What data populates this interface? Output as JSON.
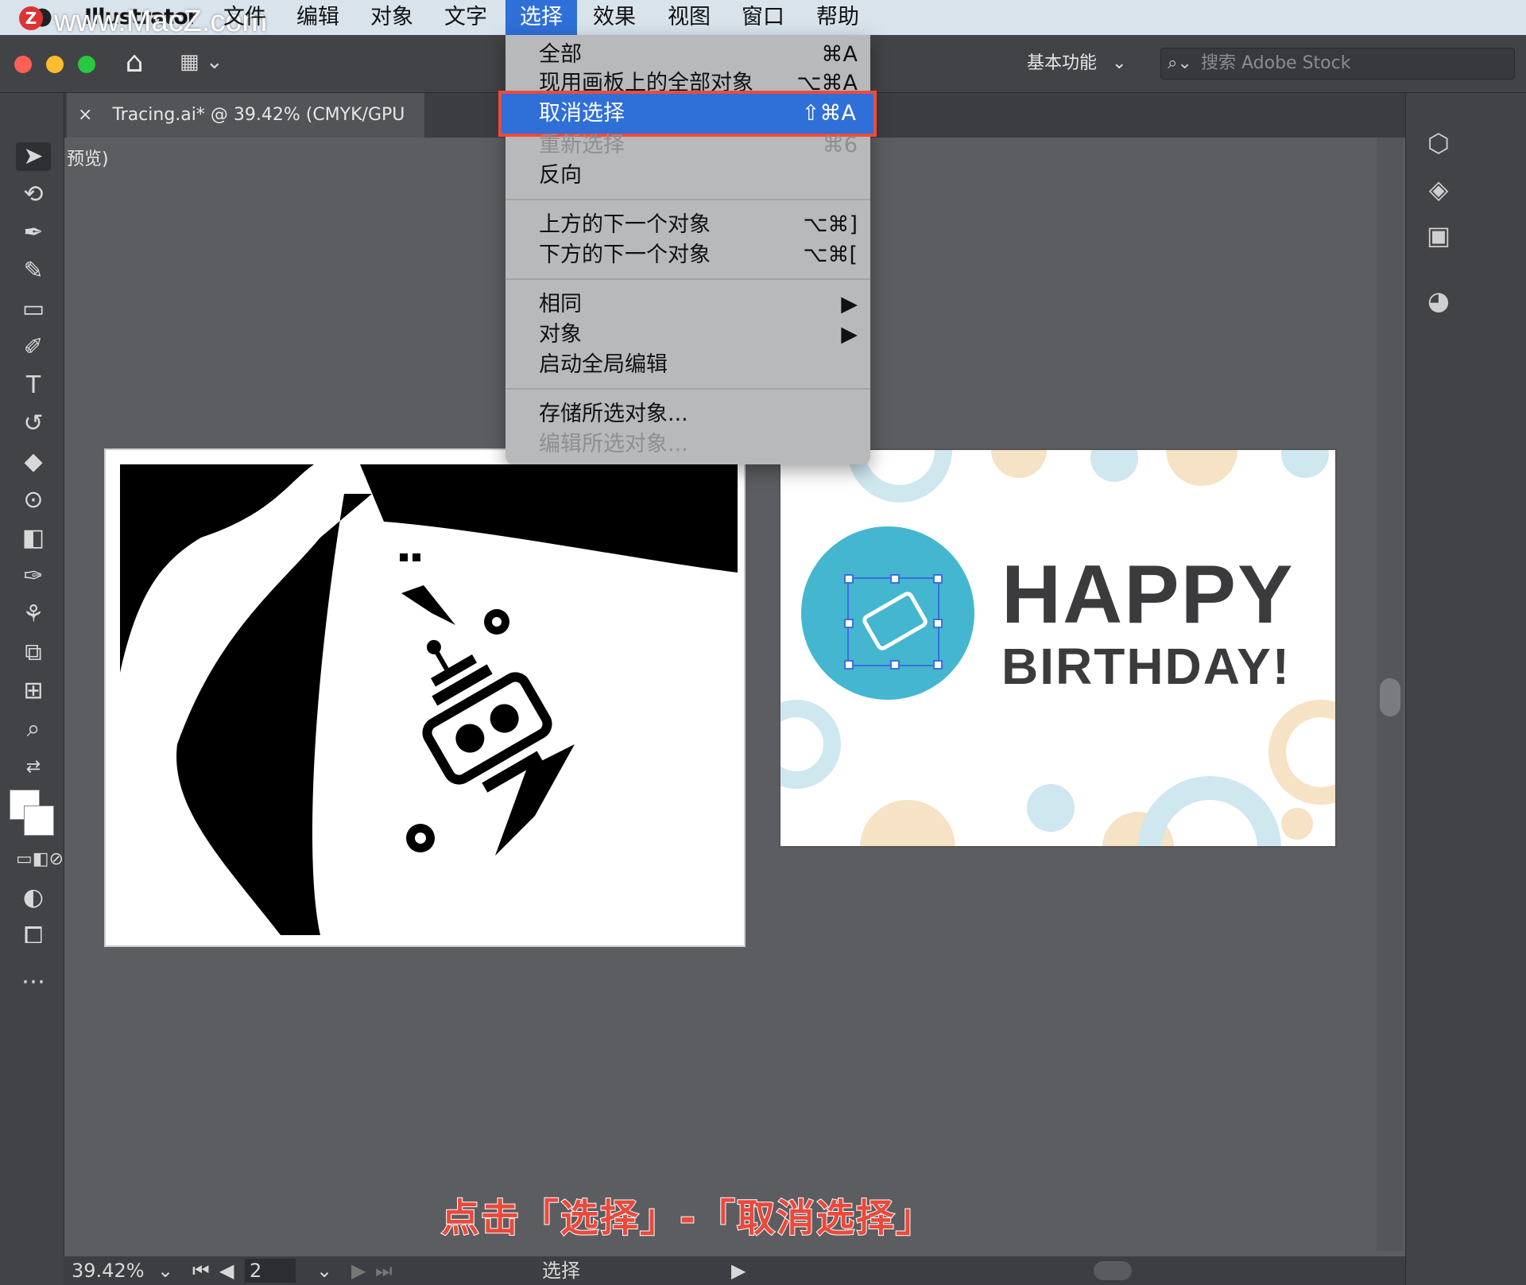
{
  "menubar": {
    "app_name": "Illustrator",
    "watermark": "www.MacZ.com",
    "items": [
      "文件",
      "编辑",
      "对象",
      "文字",
      "选择",
      "效果",
      "视图",
      "窗口",
      "帮助"
    ],
    "active_item": "选择"
  },
  "toolbar": {
    "workspace_label": "基本功能",
    "search_placeholder": "搜索 Adobe Stock"
  },
  "doc_tab": {
    "close": "×",
    "title": "Tracing.ai* @ 39.42% (CMYK/GPU 预览)"
  },
  "select_menu": {
    "items": [
      {
        "label": "全部",
        "shortcut": "⌘A",
        "disabled": false
      },
      {
        "label": "现用画板上的全部对象",
        "shortcut": "⌥⌘A",
        "disabled": false
      },
      {
        "label": "取消选择",
        "shortcut": "⇧⌘A",
        "disabled": false,
        "highlighted": true
      },
      {
        "label": "重新选择",
        "shortcut": "⌘6",
        "disabled": true
      },
      {
        "label": "反向",
        "shortcut": "",
        "disabled": false
      },
      {
        "label": "上方的下一个对象",
        "shortcut": "⌥⌘]",
        "disabled": false
      },
      {
        "label": "下方的下一个对象",
        "shortcut": "⌥⌘[",
        "disabled": false
      },
      {
        "label": "相同",
        "shortcut": "▶",
        "disabled": false
      },
      {
        "label": "对象",
        "shortcut": "▶",
        "disabled": false
      },
      {
        "label": "启动全局编辑",
        "shortcut": "",
        "disabled": false
      },
      {
        "label": "存储所选对象...",
        "shortcut": "",
        "disabled": false
      },
      {
        "label": "编辑所选对象...",
        "shortcut": "",
        "disabled": true
      }
    ]
  },
  "artboard2": {
    "line1": "HAPPY",
    "line2": "BIRTHDAY!"
  },
  "status": {
    "zoom": "39.42%",
    "page": "2",
    "tool_label": "选择"
  },
  "caption": "点击「选择」-「取消选择」",
  "colors": {
    "highlight": "#2f6fd8",
    "outline": "#f04a3c",
    "gear_blue": "#44b6d0",
    "text_dark": "#3b3b3d"
  }
}
